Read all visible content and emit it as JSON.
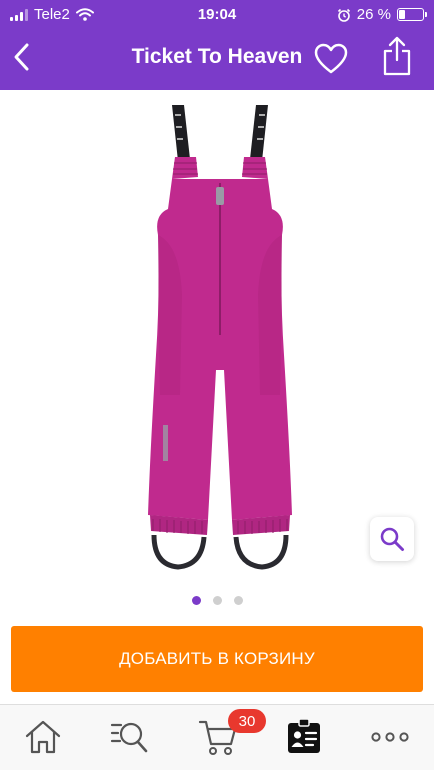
{
  "status_bar": {
    "carrier": "Tele2",
    "time": "19:04",
    "battery": "26 %",
    "battery_level": 0.26
  },
  "nav": {
    "title": "Ticket To Heaven"
  },
  "gallery": {
    "dots_total": 3,
    "active_dot": 1
  },
  "cart_button": {
    "label": "ДОБАВИТЬ В КОРЗИНУ"
  },
  "tab_bar": {
    "cart_badge": "30",
    "tabs": [
      "home-icon",
      "search-catalog-icon",
      "cart-icon",
      "profile-card-icon",
      "more-icon"
    ]
  },
  "colors": {
    "brand_purple": "#7b3bc9",
    "cart_orange": "#ff8000",
    "badge_red": "#e8382e",
    "product_magenta": "#c02a8e"
  }
}
